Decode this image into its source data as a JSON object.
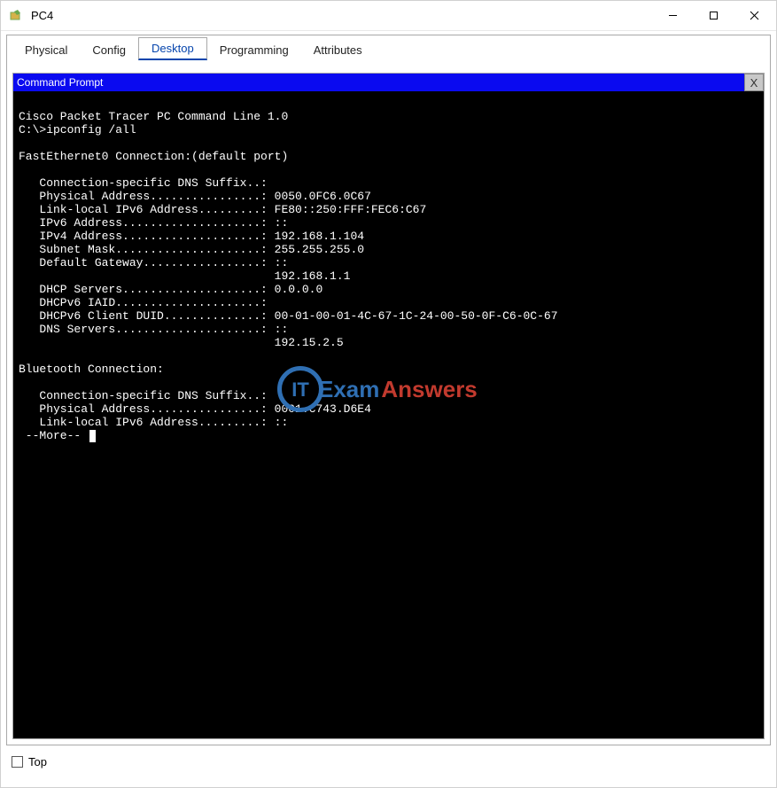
{
  "window": {
    "title": "PC4"
  },
  "tabs": {
    "items": [
      {
        "label": "Physical"
      },
      {
        "label": "Config"
      },
      {
        "label": "Desktop"
      },
      {
        "label": "Programming"
      },
      {
        "label": "Attributes"
      }
    ],
    "active_index": 2
  },
  "panel": {
    "title": "Command Prompt",
    "close_label": "X"
  },
  "terminal": {
    "lines": [
      "",
      "Cisco Packet Tracer PC Command Line 1.0",
      "C:\\>ipconfig /all",
      "",
      "FastEthernet0 Connection:(default port)",
      "",
      "   Connection-specific DNS Suffix..: ",
      "   Physical Address................: 0050.0FC6.0C67",
      "   Link-local IPv6 Address.........: FE80::250:FFF:FEC6:C67",
      "   IPv6 Address....................: ::",
      "   IPv4 Address....................: 192.168.1.104",
      "   Subnet Mask.....................: 255.255.255.0",
      "   Default Gateway.................: ::",
      "                                     192.168.1.1",
      "   DHCP Servers....................: 0.0.0.0",
      "   DHCPv6 IAID.....................: ",
      "   DHCPv6 Client DUID..............: 00-01-00-01-4C-67-1C-24-00-50-0F-C6-0C-67",
      "   DNS Servers.....................: ::",
      "                                     192.15.2.5",
      "",
      "Bluetooth Connection:",
      "",
      "   Connection-specific DNS Suffix..: ",
      "   Physical Address................: 0001.C743.D6E4",
      "   Link-local IPv6 Address.........: ::",
      " --More-- "
    ]
  },
  "footer": {
    "top_label": "Top",
    "top_checked": false
  },
  "watermark": {
    "prefix": "IT",
    "part1": "Exam",
    "part2": "Answers"
  }
}
